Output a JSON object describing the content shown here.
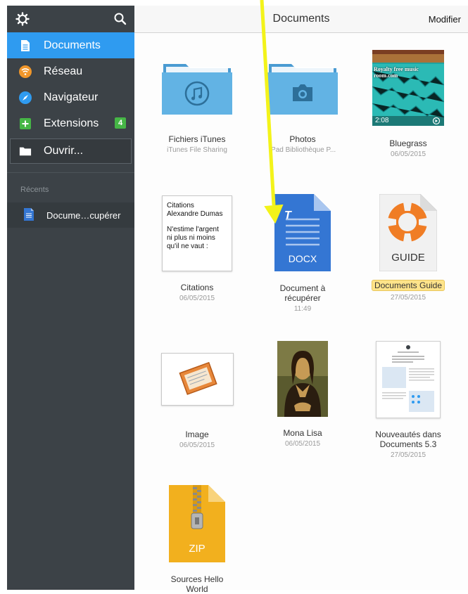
{
  "sidebar": {
    "items": [
      {
        "label": "Documents",
        "icon": "document-icon",
        "active": true
      },
      {
        "label": "Réseau",
        "icon": "network-icon"
      },
      {
        "label": "Navigateur",
        "icon": "compass-icon"
      },
      {
        "label": "Extensions",
        "icon": "plus-icon",
        "badge": "4"
      },
      {
        "label": "Ouvrir...",
        "icon": "folder-icon"
      }
    ],
    "recent_section": "Récents",
    "recent_items": [
      {
        "label": "Docume…cupérer",
        "icon": "docx-file-icon"
      }
    ]
  },
  "header": {
    "title": "Documents",
    "edit_label": "Modifier"
  },
  "files": [
    {
      "name": "Fichiers iTunes",
      "sub": "iTunes File Sharing",
      "icon": "itunes-folder-icon"
    },
    {
      "name": "Photos",
      "sub": "iPad Bibliothèque P...",
      "icon": "photos-folder-icon"
    },
    {
      "name": "Bluegrass",
      "sub": "06/05/2015",
      "duration": "2:08",
      "overlay": "Royalty free music room.com",
      "icon": "video-thumbnail"
    },
    {
      "name": "Citations",
      "sub": "06/05/2015",
      "preview": [
        "Citations",
        "Alexandre Dumas",
        "N'estime l'argent",
        "ni plus ni moins",
        "qu'il ne vaut :"
      ]
    },
    {
      "name_lines": [
        "Document à",
        "récupérer"
      ],
      "sub": "11:49",
      "badge": "DOCX",
      "icon": "docx-file-icon"
    },
    {
      "name": "Documents Guide",
      "sub": "27/05/2015",
      "badge": "GUIDE",
      "icon": "lifebuoy-icon"
    },
    {
      "name": "Image",
      "sub": "06/05/2015",
      "icon": "image-thumbnail"
    },
    {
      "name": "Mona Lisa",
      "sub": "06/05/2015",
      "icon": "painting-thumbnail"
    },
    {
      "name_lines": [
        "Nouveautés dans",
        "Documents 5.3"
      ],
      "sub": "27/05/2015",
      "icon": "pdf-thumbnail"
    },
    {
      "name_lines": [
        "Sources Hello",
        "World"
      ],
      "badge": "ZIP",
      "icon": "zip-file-icon"
    }
  ],
  "colors": {
    "accent": "#2f9bf0",
    "sidebar": "#3c4247",
    "folder": "#5aaee0",
    "docx": "#3476d3",
    "zip": "#f2b01e",
    "arrow": "#f3f31a",
    "guide": "#f07d25"
  }
}
